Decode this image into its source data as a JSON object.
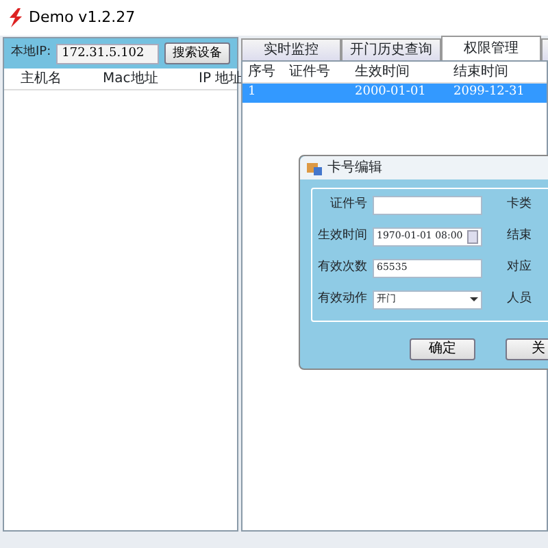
{
  "window": {
    "title": "Demo  v1.2.27"
  },
  "left_panel": {
    "ip_label": "本地IP:",
    "ip_value": "172.31.5.102",
    "search_button": "搜索设备",
    "columns": [
      "主机名",
      "Mac地址",
      "IP 地址"
    ]
  },
  "tabs": [
    {
      "label": "实时监控",
      "selected": false
    },
    {
      "label": "开门历史查询",
      "selected": false
    },
    {
      "label": "权限管理",
      "selected": true
    },
    {
      "selected": false
    }
  ],
  "table": {
    "columns": [
      "序号",
      "证件号",
      "生效时间",
      "结束时间"
    ],
    "rows": [
      {
        "cells": [
          "1",
          "",
          "2000-01-01",
          "2099-12-31"
        ],
        "selected": true
      }
    ]
  },
  "dialog": {
    "title": "卡号编辑",
    "fields": [
      {
        "label": "证件号",
        "kind": "text"
      },
      {
        "label": "生效时间",
        "kind": "datetime",
        "value": "1970-01-01 08:00"
      },
      {
        "label": "有效次数",
        "kind": "text",
        "value": "65535"
      },
      {
        "label": "有效动作",
        "kind": "select",
        "value": "开门"
      }
    ],
    "right_labels": [
      "卡类",
      "结束",
      "对应",
      "人员"
    ],
    "buttons": [
      "确定",
      "关"
    ]
  }
}
